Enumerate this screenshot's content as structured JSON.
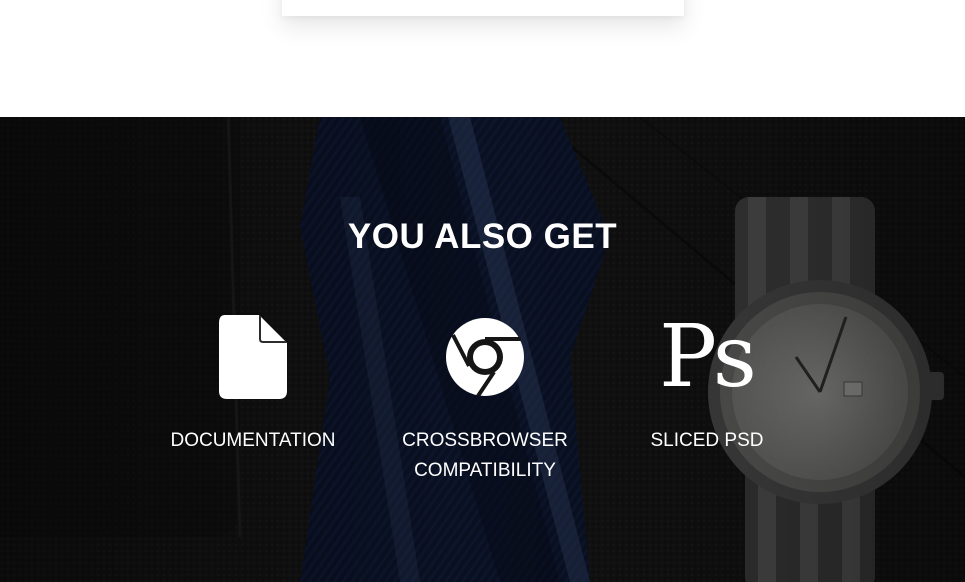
{
  "section": {
    "heading": "YOU ALSO GET",
    "features": [
      {
        "icon": "file-icon",
        "label": "DOCUMENTATION"
      },
      {
        "icon": "chrome-icon",
        "label": "CROSSBROWSER\nCOMPATIBILITY"
      },
      {
        "icon": "photoshop-icon",
        "glyph": "Ps",
        "label": "SLICED PSD"
      }
    ]
  },
  "colors": {
    "heading_text": "#ffffff",
    "overlay": "#151515",
    "page_background": "#ffffff"
  }
}
